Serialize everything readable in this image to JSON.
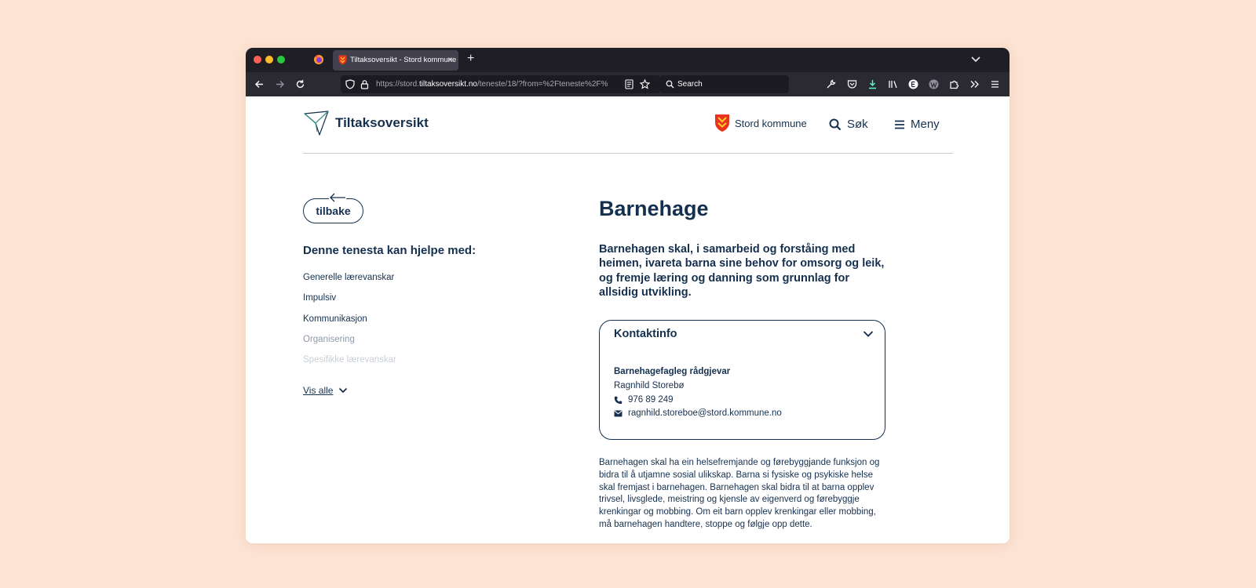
{
  "browser": {
    "tab_title": "Tiltaksoversikt - Stord kommune",
    "tab_close": "×",
    "new_tab": "+",
    "url_prefix": "https://stord.",
    "url_host": "tiltaksoversikt.no",
    "url_path": "/teneste/18/?from=%2Fteneste%2F%",
    "search_placeholder": "Search"
  },
  "header": {
    "brand": "Tiltaksoversikt",
    "kommune": "Stord kommune",
    "search_label": "Søk",
    "menu_label": "Meny"
  },
  "sidebar": {
    "back_label": "tilbake",
    "help_title": "Denne tenesta kan hjelpe med:",
    "items": [
      {
        "label": "Generelle lærevanskar",
        "color": "#15304f"
      },
      {
        "label": "Impulsiv",
        "color": "#15304f"
      },
      {
        "label": "Kommunikasjon",
        "color": "#15304f"
      },
      {
        "label": "Organisering",
        "color": "#8f9aa8"
      },
      {
        "label": "Spesifikke lærevanskar",
        "color": "#c9cfd6"
      }
    ],
    "show_all": "Vis alle"
  },
  "main": {
    "title": "Barnehage",
    "lead": "Barnehagen skal, i samarbeid og forståing med heimen, ivareta barna sine behov for omsorg og leik, og fremje læring og danning som grunnlag for allsidig utvikling.",
    "contact": {
      "title": "Kontaktinfo",
      "role": "Barnehagefagleg rådgjevar",
      "name": "Ragnhild Storebø",
      "phone": "976 89 249",
      "email": "ragnhild.storeboe@stord.kommune.no"
    },
    "body": "Barnehagen skal ha ein helsefremjande og førebyggjande funksjon og bidra til å utjamne sosial ulikskap. Barna si fysiske og psykiske helse skal fremjast i barnehagen. Barnehagen skal bidra til at barna opplev trivsel, livsglede, meistring og kjensle av eigenverd og førebyggje krenkingar og mobbing. Om eit barn opplev krenkingar eller mobbing, må barnehagen handtere, stoppe og følgje opp dette."
  },
  "colors": {
    "primary": "#15304f",
    "page_bg": "#fde3d3",
    "browser_dark": "#1f1e25",
    "toolbar": "#2b2a33",
    "download_accent": "#54ffbd"
  }
}
